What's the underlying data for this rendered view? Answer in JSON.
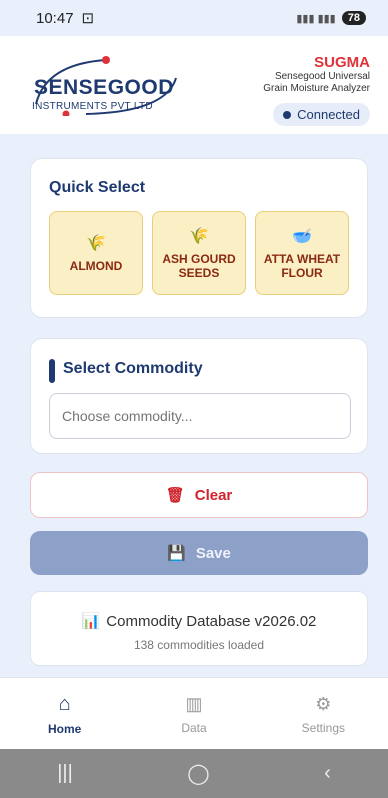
{
  "status_bar": {
    "time": "10:47",
    "battery": "78"
  },
  "header": {
    "logo_main": "SENSEGOOD",
    "logo_sub": "INSTRUMENTS PVT LTD",
    "brand_name": "SUGMA",
    "brand_line1": "Sensegood Universal",
    "brand_line2": "Grain Moisture Analyzer",
    "connection": "Connected"
  },
  "quick_select": {
    "title": "Quick Select",
    "items": [
      {
        "label": "ALMOND",
        "icon": "grain-icon"
      },
      {
        "label": "ASH GOURD SEEDS",
        "icon": "grain-icon"
      },
      {
        "label": "ATTA WHEAT FLOUR",
        "icon": "flour-bowl-icon"
      }
    ]
  },
  "select_commodity": {
    "title": "Select Commodity",
    "placeholder": "Choose commodity..."
  },
  "actions": {
    "clear_label": "Clear",
    "save_label": "Save"
  },
  "database": {
    "title": "Commodity Database v2026.02",
    "subtitle": "138 commodities loaded"
  },
  "tabs": [
    {
      "label": "Home",
      "active": true
    },
    {
      "label": "Data",
      "active": false
    },
    {
      "label": "Settings",
      "active": false
    }
  ],
  "colors": {
    "primary": "#1f3a70",
    "accent": "#e0323a",
    "quick_bg": "#fbefc6",
    "save_bg": "#8da0c8"
  }
}
